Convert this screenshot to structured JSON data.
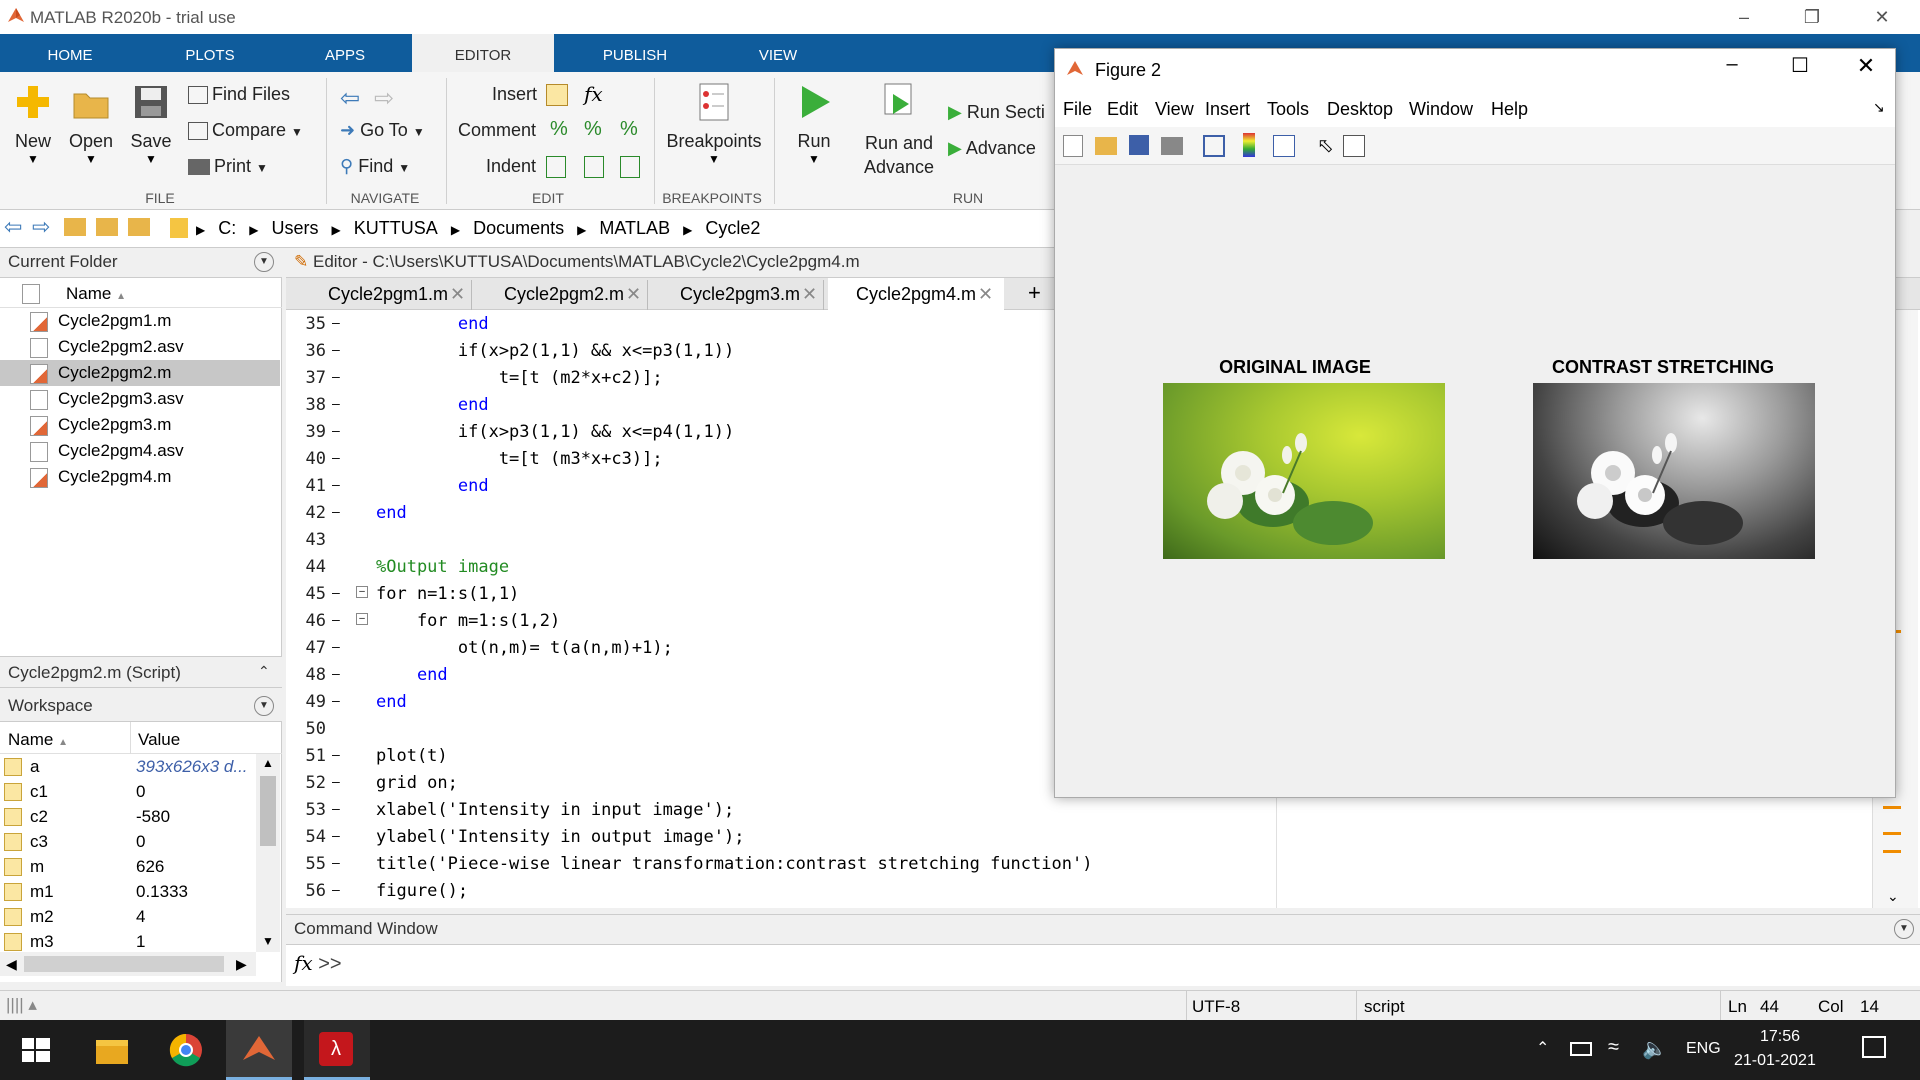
{
  "window": {
    "title": "MATLAB R2020b - trial use"
  },
  "tabs": [
    "HOME",
    "PLOTS",
    "APPS",
    "EDITOR",
    "PUBLISH",
    "VIEW"
  ],
  "ribbon": {
    "file": {
      "new": "New",
      "open": "Open",
      "save": "Save",
      "find_files": "Find Files",
      "compare": "Compare",
      "print": "Print",
      "group": "FILE"
    },
    "navigate": {
      "go_to": "Go To",
      "find": "Find",
      "group": "NAVIGATE"
    },
    "edit": {
      "insert": "Insert",
      "comment": "Comment",
      "indent": "Indent",
      "group": "EDIT"
    },
    "breakpoints": {
      "label": "Breakpoints",
      "group": "BREAKPOINTS"
    },
    "run": {
      "run": "Run",
      "run_advance_1": "Run and",
      "run_advance_2": "Advance",
      "run_section": "Run Secti",
      "advance": "Advance",
      "group": "RUN"
    }
  },
  "address": [
    "C:",
    "Users",
    "KUTTUSA",
    "Documents",
    "MATLAB",
    "Cycle2"
  ],
  "current_folder": {
    "title": "Current Folder",
    "col_name": "Name",
    "files": [
      "Cycle2pgm1.m",
      "Cycle2pgm2.asv",
      "Cycle2pgm2.m",
      "Cycle2pgm3.asv",
      "Cycle2pgm3.m",
      "Cycle2pgm4.asv",
      "Cycle2pgm4.m"
    ],
    "details": "Cycle2pgm2.m  (Script)"
  },
  "workspace": {
    "title": "Workspace",
    "col_name": "Name",
    "col_value": "Value",
    "vars": [
      {
        "name": "a",
        "value": "393x626x3 d..."
      },
      {
        "name": "c1",
        "value": "0"
      },
      {
        "name": "c2",
        "value": "-580"
      },
      {
        "name": "c3",
        "value": "0"
      },
      {
        "name": "m",
        "value": "626"
      },
      {
        "name": "m1",
        "value": "0.1333"
      },
      {
        "name": "m2",
        "value": "4"
      },
      {
        "name": "m3",
        "value": "1"
      }
    ]
  },
  "editor": {
    "title": "Editor - C:\\Users\\KUTTUSA\\Documents\\MATLAB\\Cycle2\\Cycle2pgm4.m",
    "tabs": [
      "Cycle2pgm1.m",
      "Cycle2pgm2.m",
      "Cycle2pgm3.m",
      "Cycle2pgm4.m"
    ],
    "lines": [
      {
        "n": "35",
        "code": "        end"
      },
      {
        "n": "36",
        "code": "        if(x>p2(1,1) && x<=p3(1,1))"
      },
      {
        "n": "37",
        "code": "            t=[t (m2*x+c2)];"
      },
      {
        "n": "38",
        "code": "        end"
      },
      {
        "n": "39",
        "code": "        if(x>p3(1,1) && x<=p4(1,1))"
      },
      {
        "n": "40",
        "code": "            t=[t (m3*x+c3)];"
      },
      {
        "n": "41",
        "code": "        end"
      },
      {
        "n": "42",
        "code": "end"
      },
      {
        "n": "43",
        "code": ""
      },
      {
        "n": "44",
        "code": "%Output image"
      },
      {
        "n": "45",
        "code": "for n=1:s(1,1)"
      },
      {
        "n": "46",
        "code": "    for m=1:s(1,2)"
      },
      {
        "n": "47",
        "code": "        ot(n,m)= t(a(n,m)+1);"
      },
      {
        "n": "48",
        "code": "    end"
      },
      {
        "n": "49",
        "code": "end"
      },
      {
        "n": "50",
        "code": ""
      },
      {
        "n": "51",
        "code": "plot(t)"
      },
      {
        "n": "52",
        "code": "grid on;"
      },
      {
        "n": "53",
        "code": "xlabel('Intensity in input image');"
      },
      {
        "n": "54",
        "code": "ylabel('Intensity in output image');"
      },
      {
        "n": "55",
        "code": "title('Piece-wise linear transformation:contrast stretching function')"
      },
      {
        "n": "56",
        "code": "figure();"
      }
    ]
  },
  "command_window": {
    "title": "Command Window",
    "fx": "fx",
    "prompt": ">>"
  },
  "statusbar": {
    "encoding": "UTF-8",
    "type": "script",
    "ln_label": "Ln",
    "ln": "44",
    "col_label": "Col",
    "col": "14"
  },
  "figure": {
    "title": "Figure 2",
    "menu": [
      "File",
      "Edit",
      "View",
      "Insert",
      "Tools",
      "Desktop",
      "Window",
      "Help"
    ],
    "image1_title": "ORIGINAL IMAGE",
    "image2_title": "CONTRAST STRETCHING"
  },
  "taskbar": {
    "lang": "ENG",
    "time": "17:56",
    "date": "21-01-2021"
  }
}
